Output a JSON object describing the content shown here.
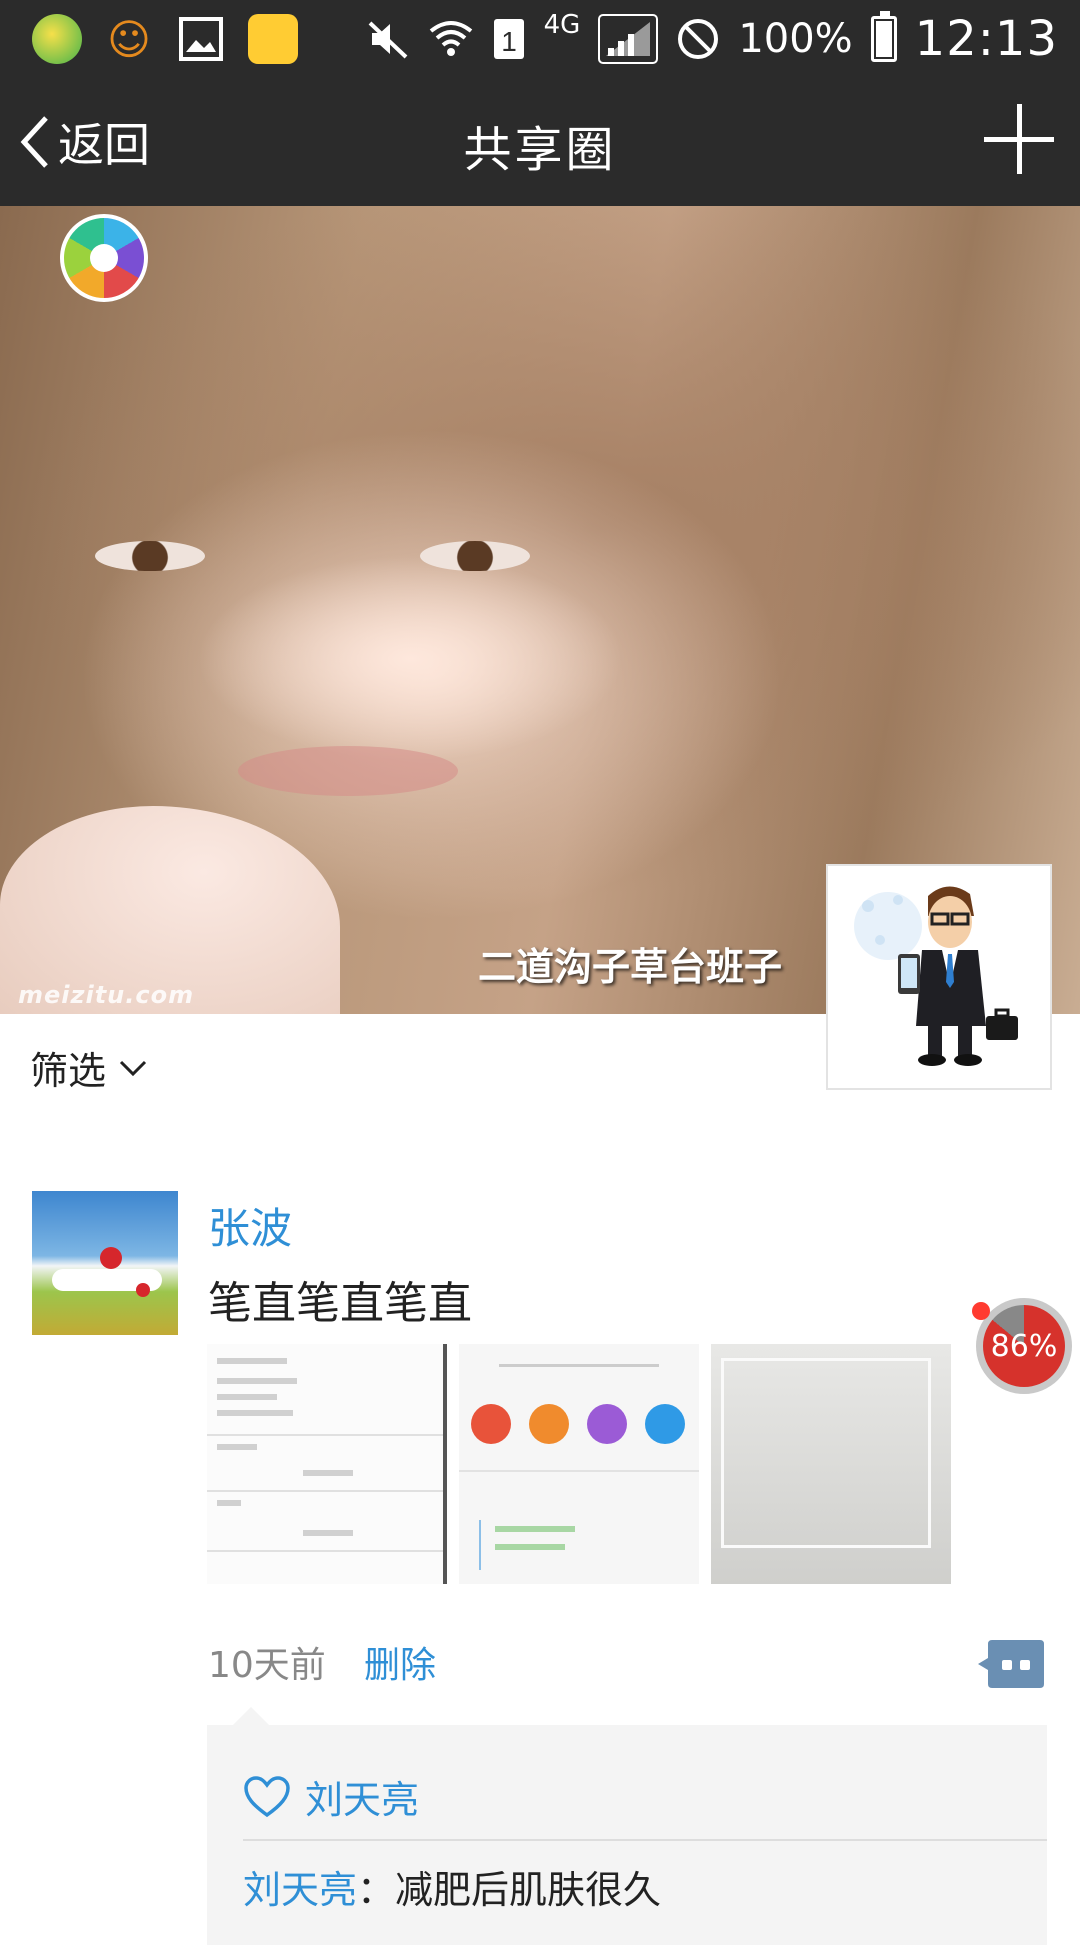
{
  "status_bar": {
    "signal_label": "4G",
    "sim_label": "1",
    "battery": "100%",
    "time": "12:13",
    "left_icons": [
      "plus-circle-icon",
      "smiley-icon",
      "gallery-icon",
      "gift-icon"
    ],
    "right_icons": [
      "mute-icon",
      "wifi-icon",
      "sim-icon",
      "signal-icon",
      "block-icon",
      "battery-icon"
    ]
  },
  "header": {
    "back_label": "返回",
    "title": "共享圈",
    "add_icon": "plus-icon",
    "bg_color": "#2b2b2b"
  },
  "cover": {
    "watermark": "meizitu.com",
    "group_name": "二道沟子草台班子"
  },
  "filter": {
    "label": "筛选",
    "icon": "chevron-down-icon"
  },
  "post": {
    "author": "张波",
    "text": "笔直笔直笔直",
    "images_count": 3,
    "time": "10天前",
    "delete_label": "删除",
    "comment_icon": "comment-icon",
    "likes": [
      "刘天亮"
    ],
    "comments": [
      {
        "user": "刘天亮",
        "separator": "：",
        "text": "减肥后肌肤很久"
      }
    ]
  },
  "floating_badge": {
    "percent_label": "86%",
    "percent": 86
  },
  "colors": {
    "accent": "#2f8fd6",
    "text": "#222222",
    "muted": "#888888",
    "comment_bg": "#f4f4f4"
  }
}
